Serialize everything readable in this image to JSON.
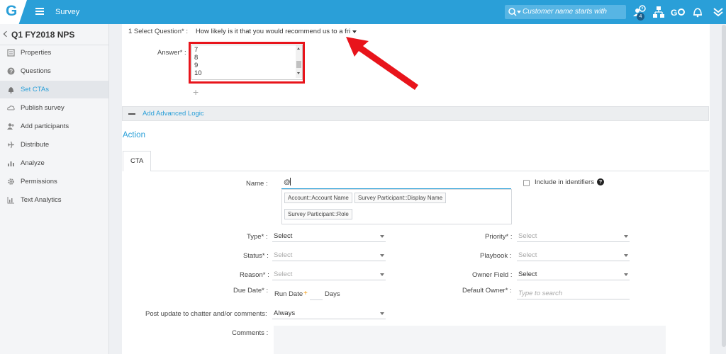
{
  "topbar": {
    "logo": "G",
    "app_title": "Survey",
    "search_placeholder": "Customer name starts with",
    "notification_badge": "4",
    "icons": [
      "search-icon",
      "user-activity-icon",
      "org-chart-icon",
      "go-icon",
      "bell-icon",
      "double-chevron-down-icon"
    ]
  },
  "sidebar": {
    "title": "Q1 FY2018 NPS",
    "items": [
      {
        "label": "Properties",
        "icon": "list-icon",
        "active": false
      },
      {
        "label": "Questions",
        "icon": "question-icon",
        "active": false
      },
      {
        "label": "Set CTAs",
        "icon": "bell-icon",
        "active": true
      },
      {
        "label": "Publish survey",
        "icon": "cloud-icon",
        "active": false
      },
      {
        "label": "Add participants",
        "icon": "add-user-icon",
        "active": false
      },
      {
        "label": "Distribute",
        "icon": "plane-icon",
        "active": false
      },
      {
        "label": "Analyze",
        "icon": "bar-chart-icon",
        "active": false
      },
      {
        "label": "Permissions",
        "icon": "gear-icon",
        "active": false
      },
      {
        "label": "Text Analytics",
        "icon": "text-chart-icon",
        "active": false
      }
    ]
  },
  "question": {
    "label": "1 Select Question* :",
    "value": "How likely is it that you would recommend us to a fri",
    "answer_label": "Answer* :",
    "answers": [
      "7",
      "8",
      "9",
      "10"
    ]
  },
  "advanced_logic": {
    "label": "Add Advanced Logic"
  },
  "action": {
    "title": "Action",
    "tab": "CTA",
    "name_label": "Name :",
    "name_value": "@",
    "tokens": [
      "Account::Account Name",
      "Survey Participant::Display Name",
      "Survey Participant::Role"
    ],
    "include_identifiers": "Include in identifiers",
    "type": {
      "label": "Type* :",
      "value": "Select"
    },
    "status": {
      "label": "Status* :",
      "value": "Select"
    },
    "reason": {
      "label": "Reason* :",
      "value": "Select"
    },
    "due_date": {
      "label": "Due Date* :",
      "value": "Run Date",
      "plus": "+",
      "days": "Days"
    },
    "post_update": {
      "label": "Post update to chatter and/or comments:",
      "value": "Always"
    },
    "comments_label": "Comments :",
    "priority": {
      "label": "Priority* :",
      "value": "Select"
    },
    "playbook": {
      "label": "Playbook :",
      "value": "Select"
    },
    "owner_field": {
      "label": "Owner Field :",
      "value": "Select"
    },
    "default_owner": {
      "label": "Default Owner* :",
      "placeholder": "Type to search"
    }
  },
  "colors": {
    "brand": "#2a9fd8",
    "highlight": "#e8141b"
  }
}
